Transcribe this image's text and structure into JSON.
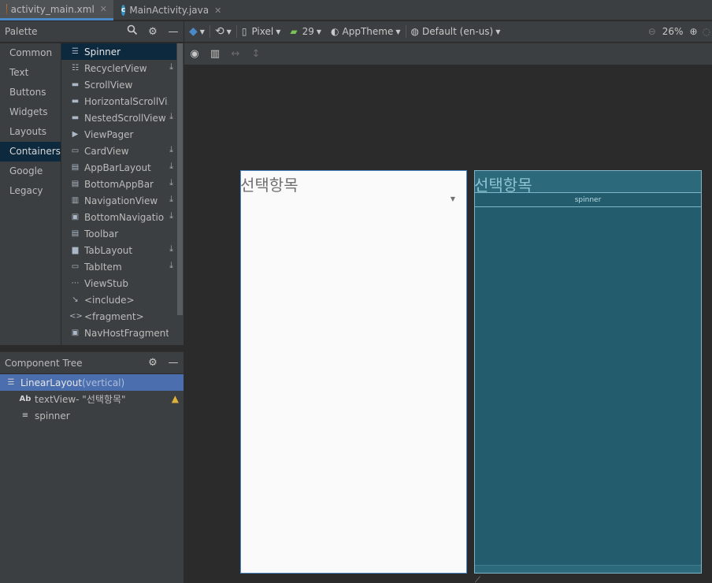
{
  "tabs": [
    {
      "label": "activity_main.xml",
      "icon": "xml-file-icon",
      "active": true
    },
    {
      "label": "MainActivity.java",
      "icon": "java-class-icon",
      "active": false
    }
  ],
  "palette": {
    "title": "Palette",
    "categories": [
      "Common",
      "Text",
      "Buttons",
      "Widgets",
      "Layouts",
      "Containers",
      "Google",
      "Legacy"
    ],
    "selected_category": "Containers",
    "components": [
      {
        "label": "Spinner",
        "download": false
      },
      {
        "label": "RecyclerView",
        "download": true
      },
      {
        "label": "ScrollView",
        "download": false
      },
      {
        "label": "HorizontalScrollVi...",
        "download": false
      },
      {
        "label": "NestedScrollView",
        "download": true
      },
      {
        "label": "ViewPager",
        "download": false
      },
      {
        "label": "CardView",
        "download": true
      },
      {
        "label": "AppBarLayout",
        "download": true
      },
      {
        "label": "BottomAppBar",
        "download": true
      },
      {
        "label": "NavigationView",
        "download": true
      },
      {
        "label": "BottomNavigatio",
        "download": true
      },
      {
        "label": "Toolbar",
        "download": false
      },
      {
        "label": "TabLayout",
        "download": true
      },
      {
        "label": "TabItem",
        "download": true
      },
      {
        "label": "ViewStub",
        "download": false
      },
      {
        "label": "<include>",
        "download": false
      },
      {
        "label": "<fragment>",
        "download": false
      },
      {
        "label": "NavHostFragment",
        "download": false
      }
    ]
  },
  "tree": {
    "title": "Component Tree",
    "root": {
      "name": "LinearLayout",
      "suffix": "(vertical)"
    },
    "children": [
      {
        "prefix": "Ab",
        "name": "textView- \"선택항목\"",
        "warning": true
      },
      {
        "prefix": "≡",
        "name": "spinner",
        "warning": false
      }
    ]
  },
  "toolbar": {
    "device": "Pixel",
    "api": "29",
    "theme": "AppTheme",
    "locale": "Default (en-us)",
    "zoom": "26%"
  },
  "design_view": {
    "text": "선택항목"
  },
  "blueprint_view": {
    "text": "선택항목",
    "spinner_label": "spinner"
  }
}
